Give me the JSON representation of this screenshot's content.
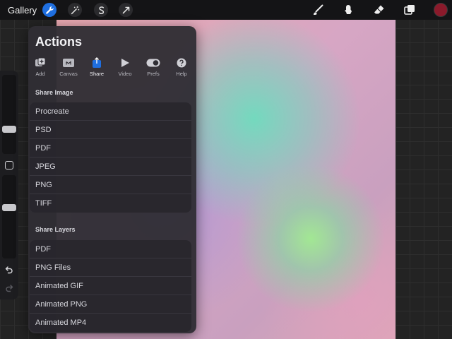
{
  "topbar": {
    "gallery_label": "Gallery",
    "left_tools": [
      {
        "icon": "wrench-icon",
        "active": true
      },
      {
        "icon": "magic-wand-icon",
        "active": false
      },
      {
        "icon": "selection-s-icon",
        "active": false
      },
      {
        "icon": "transform-arrow-icon",
        "active": false
      }
    ],
    "right_tools": [
      "brush-icon",
      "smudge-icon",
      "eraser-icon",
      "layers-icon"
    ],
    "active_color": "#8b1a2b",
    "accent_color": "#1f6fe0"
  },
  "actions": {
    "title": "Actions",
    "tabs": [
      {
        "label": "Add",
        "icon": "add-icon"
      },
      {
        "label": "Canvas",
        "icon": "canvas-icon"
      },
      {
        "label": "Share",
        "icon": "share-icon",
        "active": true
      },
      {
        "label": "Video",
        "icon": "video-icon"
      },
      {
        "label": "Prefs",
        "icon": "toggle-icon"
      },
      {
        "label": "Help",
        "icon": "help-icon"
      }
    ],
    "share_image": {
      "heading": "Share Image",
      "items": [
        "Procreate",
        "PSD",
        "PDF",
        "JPEG",
        "PNG",
        "TIFF"
      ]
    },
    "share_layers": {
      "heading": "Share Layers",
      "items": [
        "PDF",
        "PNG Files",
        "Animated GIF",
        "Animated PNG",
        "Animated MP4"
      ]
    }
  },
  "sidebar": {
    "brush_size_level": 0.29,
    "opacity_level": 0.62
  }
}
